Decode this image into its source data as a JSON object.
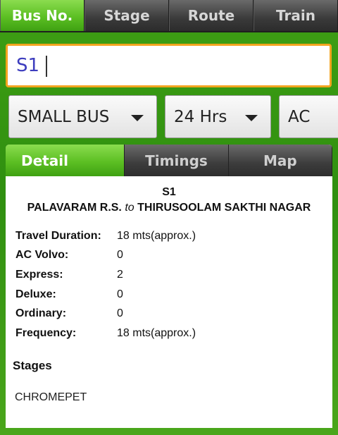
{
  "top_tabs": [
    {
      "label": "Bus No.",
      "active": true
    },
    {
      "label": "Stage",
      "active": false
    },
    {
      "label": "Route",
      "active": false
    },
    {
      "label": "Train",
      "active": false
    }
  ],
  "search": {
    "value": "S1"
  },
  "filters": {
    "bus_type": "SMALL BUS",
    "hours": "24 Hrs",
    "ac": "AC"
  },
  "detail_tabs": [
    {
      "label": "Detail",
      "active": true
    },
    {
      "label": "Timings",
      "active": false
    },
    {
      "label": "Map",
      "active": false
    }
  ],
  "route": {
    "number": "S1",
    "from": "PALAVARAM R.S.",
    "to_word": "to",
    "to": "THIRUSOOLAM SAKTHI NAGAR"
  },
  "info": [
    {
      "label": "Travel Duration:",
      "value": "18 mts(approx.)"
    },
    {
      "label": "AC Volvo:",
      "value": "0"
    },
    {
      "label": "Express:",
      "value": "2"
    },
    {
      "label": "Deluxe:",
      "value": "0"
    },
    {
      "label": "Ordinary:",
      "value": "0"
    },
    {
      "label": "Frequency:",
      "value": "18 mts(approx.)"
    }
  ],
  "stages": {
    "title": "Stages",
    "items": [
      "CHROMEPET"
    ]
  },
  "colors": {
    "accent_green": "#5cbf23",
    "search_border": "#f3a41f",
    "search_text": "#3d3dbe"
  }
}
